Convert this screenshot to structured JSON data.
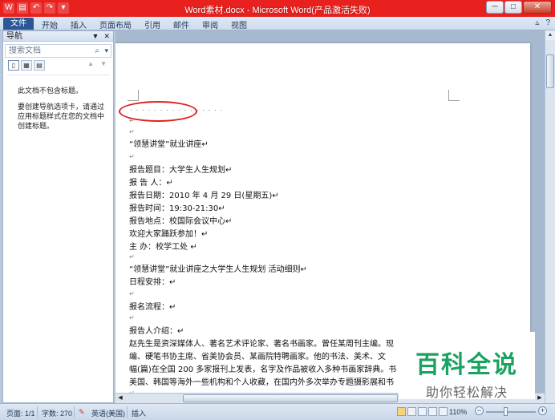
{
  "window": {
    "title": "Word素材.docx - Microsoft Word(产品激活失败)",
    "minimize": "─",
    "maximize": "□",
    "close": "✕"
  },
  "qat": {
    "word_icon": "W",
    "save_icon": "▤",
    "undo_icon": "↶",
    "redo_icon": "↷",
    "customize_icon": "▾"
  },
  "ribbon": {
    "file_tab": "文件",
    "tabs": [
      "开始",
      "插入",
      "页面布局",
      "引用",
      "邮件",
      "审阅",
      "视图"
    ],
    "help_icon": "?",
    "collapse_icon": "▵"
  },
  "nav": {
    "title": "导航",
    "dropdown_icon": "▼",
    "close_icon": "✕",
    "search_placeholder": "搜索文档",
    "search_icon": "⌕",
    "search_dropdown": "▾",
    "up_arrow": "▲",
    "down_arrow": "▼",
    "msg1": "此文档不包含标题。",
    "msg2": "要创建导航选项卡，请通过应用标题样式在您的文档中创建标题。"
  },
  "document": {
    "dots": "· · · · · · · · · · · · · · · ·",
    "para_mark": "↵",
    "lines": {
      "l1": "“领慧讲堂”就业讲座↵",
      "l2": "报告题目：大学生人生规划↵",
      "l3": "报  告  人：↵",
      "l4": "报告日期：2010 年 4 月 29 日(星期五)↵",
      "l5": "报告时间：19:30-21:30↵",
      "l6": "报告地点：校国际会议中心↵",
      "l7": "欢迎大家踊跃参加！↵",
      "l8": "主  办：校学工处 ↵",
      "l9": "“领慧讲堂”就业讲座之大学生人生规划  活动细则↵",
      "l10": "日程安排：↵",
      "l11": "报名流程：↵",
      "l12": "报告人介绍：↵",
      "l13": "赵先生是资深媒体人、著名艺术评论家、著名书画家。曾任某周刊主编。现",
      "l14": "编、硬笔书协主席、省美协会员、某画院特聘画家。他的书法、美术、文",
      "l15": "幅(篇)在全国 200 多家报刊上发表，名字及作品被收入多种书画家辞典。书",
      "l16": "美国、韩国等海外一些机构和个人收藏，在国内外多次举办专题摄影展和书"
    }
  },
  "status": {
    "page": "页面: 1/1",
    "words": "字数: 270",
    "lang": "英语(美国)",
    "mode": "插入",
    "zoom": "110%",
    "zoom_minus": "−",
    "zoom_plus": "+",
    "zoom_level": 0.4
  },
  "watermark": {
    "line1": "百科全说",
    "line2": "助你轻松解决"
  }
}
